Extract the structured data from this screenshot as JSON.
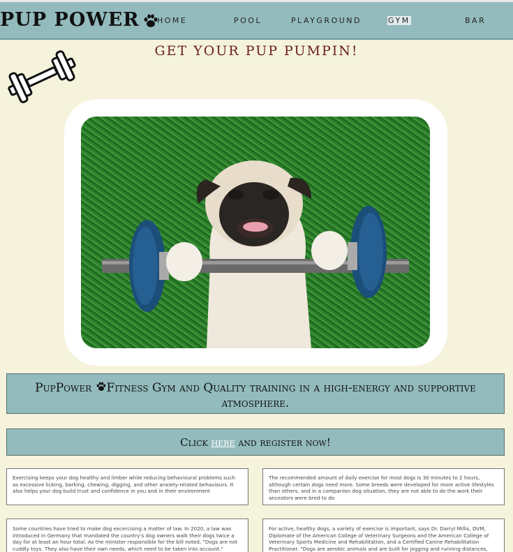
{
  "nav": {
    "brand": "PUP POWER",
    "links": [
      "HOME",
      "POOL",
      "PLAYGROUND",
      "GYM",
      "BAR"
    ],
    "active": "GYM"
  },
  "headline": "Get your pup pumpin!",
  "banner1": {
    "brand": "PupPower",
    "text": "Fitness Gym and Quality training in a high-energy and supportive atmosphere."
  },
  "banner2": {
    "pre": "Click",
    "link": "here",
    "post": "and register now!"
  },
  "cards": [
    "Exercising keeps your dog healthy and limber while reducing behavioural problems such as excessive licking, barking, chewing, digging, and other anxiety-related behaviours. It also helps your dog build trust and confidence in you and in their environment",
    "The recommended amount of daily exercise for most dogs is 30 minutes to 2 hours, although certain dogs need more. Some breeds were developed for more active lifestyles than others, and in a companion dog situation, they are not able to do the work their ancestors were bred to do",
    "Some countries have tried to make dog excercising a matter of law. In 2020, a law was introduced in Germany that mandated the country's dog owners walk their dogs twice a day for at least an hour total. As the minister responsible for the bill noted, \"Dogs are not cuddly toys. They also have their own needs, which need to be taken into account.\"",
    "For active, healthy dogs, a variety of exercise is important, says Dr. Darryl Millis, DVM, Diplomate of the American College of Veterinary Surgeons and the American College of Veterinary Sports Medicine and Rehabilitation, and a Certified Canine Rehabilitation Practitioner. \"Dogs are aerobic animals and are built for jogging and running distances,"
  ],
  "colors": {
    "background": "#f5f3dc",
    "nav": "#93bbbd",
    "headline": "#6b1e24"
  },
  "icons": [
    "paw-icon",
    "dumbbell-icon"
  ]
}
